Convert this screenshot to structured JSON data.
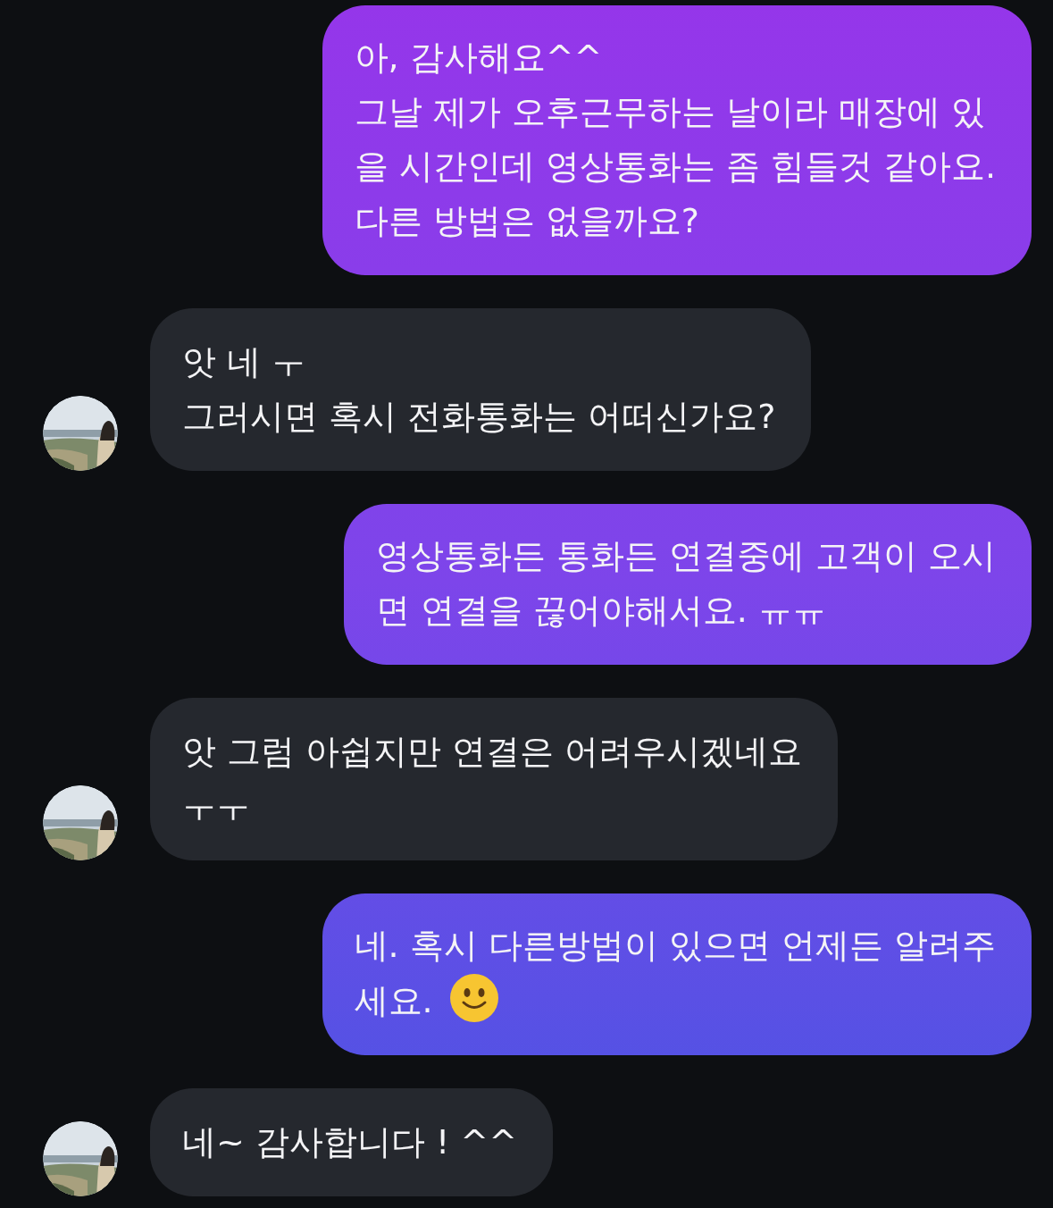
{
  "messages": [
    {
      "kind": "sent",
      "text": "아, 감사해요^^\n그날 제가 오후근무하는 날이라 매장에 있\n을 시간인데 영상통화는 좀 힘들것 같아요.\n다른 방법은 없을까요?"
    },
    {
      "kind": "received",
      "text": "앗 네 ㅜ\n그러시면 혹시 전화통화는 어떠신가요?"
    },
    {
      "kind": "sent",
      "text": "영상통화든 통화든 연결중에 고객이 오시\n면 연결을 끊어야해서요. ㅠㅠ"
    },
    {
      "kind": "received",
      "text": "앗 그럼 아쉽지만 연결은 어려우시겠네요\nㅜㅜ"
    },
    {
      "kind": "sent",
      "text": "네. 혹시 다른방법이 있으면 언제든 알려주\n세요.",
      "smiley": true
    },
    {
      "kind": "received",
      "text": "네~ 감사합니다 ! ^^"
    }
  ]
}
